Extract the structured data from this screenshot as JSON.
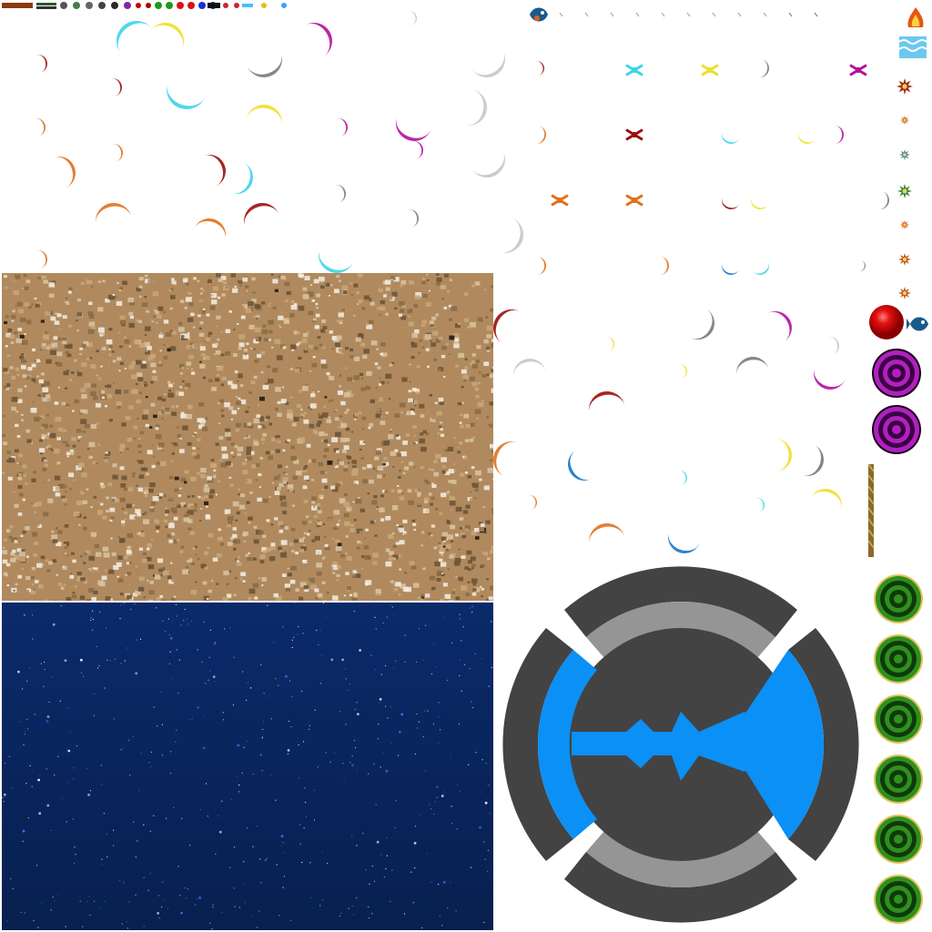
{
  "atlas": {
    "background": "#ffffff",
    "panels": {
      "sand": {
        "base": "#b08a5e",
        "light": "#d9c4a4",
        "dark": "#6a5136",
        "speck": "#f4efe6",
        "black": "#1b140e"
      },
      "space": {
        "base": "#0b2a6a",
        "deep": "#07204f",
        "star": "#e8f0ff",
        "blue_star": "#4a6bff"
      }
    },
    "emblem": {
      "outer": "#434343",
      "band": "#959595",
      "accent": "#0b90f6"
    },
    "buttons": {
      "red": "#e41010",
      "purple": {
        "ring": "#b020c0",
        "dark": "#3a0040"
      },
      "green": {
        "ring": "#2f8f1f",
        "dark": "#0f3a0a",
        "rim": "#e0c35a"
      },
      "count_green": 6,
      "count_purple": 2
    },
    "slash_palette": [
      "#9b0d0d",
      "#3ad4ea",
      "#ece02a",
      "#7a7a7a",
      "#b4119c",
      "#e0701a",
      "#c7c7c7",
      "#1a75c8"
    ],
    "icons": [
      "crescent-slash-icon",
      "spark-icon",
      "star-burst-icon",
      "gem-strip-icon",
      "fire-icon",
      "water-icon",
      "fish-creature-icon",
      "rope-icon"
    ]
  }
}
